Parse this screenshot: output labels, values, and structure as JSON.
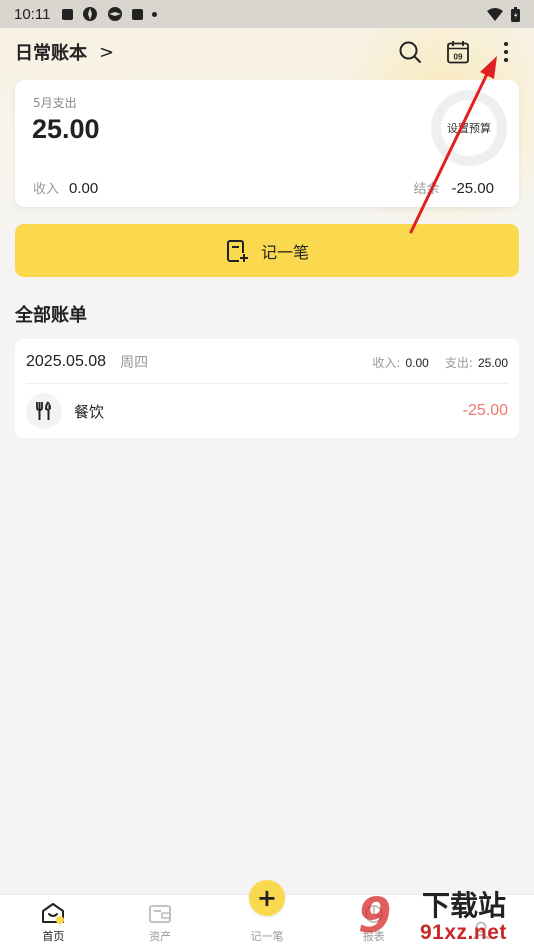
{
  "status_bar": {
    "time": "10:11"
  },
  "header": {
    "book_title": "日常账本",
    "chevron": ">"
  },
  "summary": {
    "month_label": "5月支出",
    "month_expense": "25.00",
    "budget_label": "设置预算",
    "income_label": "收入",
    "income_value": "0.00",
    "balance_label": "结余",
    "balance_value": "-25.00"
  },
  "record_button": {
    "label": "记一笔"
  },
  "section": {
    "title": "全部账单"
  },
  "bills": {
    "date": "2025.05.08",
    "weekday": "周四",
    "income_label": "收入:",
    "income_value": "0.00",
    "expense_label": "支出:",
    "expense_value": "25.00",
    "items": [
      {
        "category": "餐饮",
        "amount": "-25.00",
        "icon": "utensils-icon"
      }
    ]
  },
  "bottom_nav": {
    "items": [
      {
        "label": "首页",
        "icon": "home-icon",
        "active": true
      },
      {
        "label": "资产",
        "icon": "wallet-icon",
        "active": false
      },
      {
        "label": "记一笔",
        "icon": "plus-icon",
        "active": false
      },
      {
        "label": "报表",
        "icon": "report-icon",
        "active": false
      },
      {
        "label": "",
        "icon": "profile-icon",
        "active": false
      }
    ]
  },
  "watermark": {
    "number": "9",
    "text": "下载站",
    "url": "91xz.net"
  },
  "colors": {
    "accent": "#fbd94f",
    "expense": "#f0776a",
    "annotation": "#e02020"
  }
}
